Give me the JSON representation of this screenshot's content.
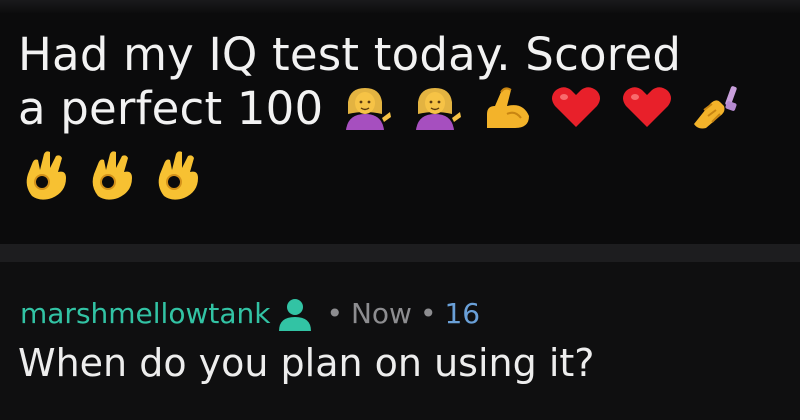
{
  "post": {
    "title_line1": "Had my IQ test today. Scored",
    "title_line2": "a perfect 100",
    "title_emojis": [
      "woman-tipping-hand-emoji",
      "woman-tipping-hand-emoji",
      "flexed-biceps-emoji",
      "red-heart-emoji",
      "red-heart-emoji",
      "nail-polish-emoji"
    ],
    "emoji_row": [
      "ok-hand-emoji",
      "ok-hand-emoji",
      "ok-hand-emoji"
    ]
  },
  "comment": {
    "author": "marshmellowtank",
    "author_icon": "user-icon",
    "separator": "•",
    "time": "Now",
    "score": "16",
    "body": "When do you plan on using it?"
  },
  "colors": {
    "background": "#0b0b0c",
    "author": "#32c3a4",
    "meta": "#8d8d90",
    "score": "#6aa0d8",
    "text": "#f2f2f2"
  }
}
